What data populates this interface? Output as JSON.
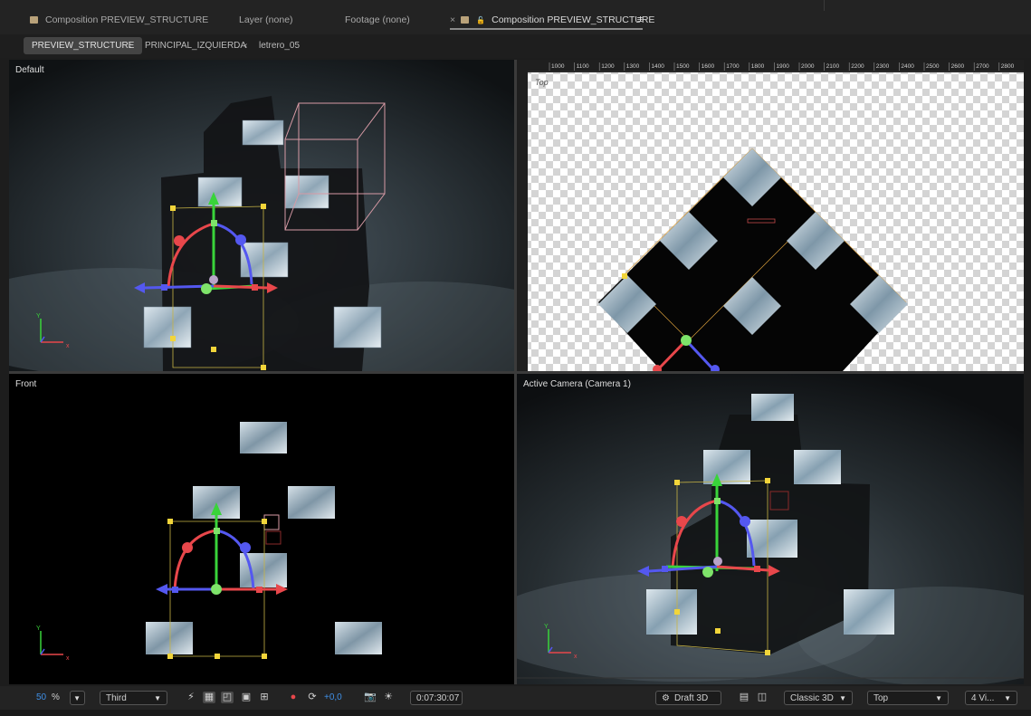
{
  "tabs": [
    {
      "label": "Composition PREVIEW_STRUCTURE"
    },
    {
      "label": "Layer (none)"
    },
    {
      "label": "Footage (none)"
    },
    {
      "label": "Composition PREVIEW_STRUCTURE",
      "close": "×",
      "active": true
    }
  ],
  "breadcrumb": [
    "PREVIEW_STRUCTURE",
    "PRINCIPAL_IZQUIERDA",
    "letrero_05"
  ],
  "breadcrumb_sep": "‹",
  "panes": {
    "default": {
      "label": "Default"
    },
    "top": {
      "label": "Top",
      "ruler_ticks": [
        "1000",
        "1100",
        "1200",
        "1300",
        "1400",
        "1500",
        "1600",
        "1700",
        "1800",
        "1900",
        "2000",
        "2100",
        "2200",
        "2300",
        "2400",
        "2500",
        "2600",
        "2700",
        "2800"
      ]
    },
    "front": {
      "label": "Front"
    },
    "camera": {
      "label": "Active Camera (Camera 1)"
    }
  },
  "axis_labels": {
    "x": "x",
    "y": "Y"
  },
  "toolbar": {
    "zoom": "50",
    "zoom_unit": "%",
    "resolution": "Third",
    "exposure": "+0,0",
    "timecode": "0:07:30:07",
    "renderer_label": "Draft 3D",
    "renderer_mode": "Classic 3D",
    "view": "Top",
    "layout": "4 Vi..."
  },
  "colors": {
    "accent": "#2d8ceb",
    "gizmo_x": "#e8474b",
    "gizmo_y": "#39d43a",
    "gizmo_z": "#5458f0",
    "handle": "#f2d53a"
  }
}
